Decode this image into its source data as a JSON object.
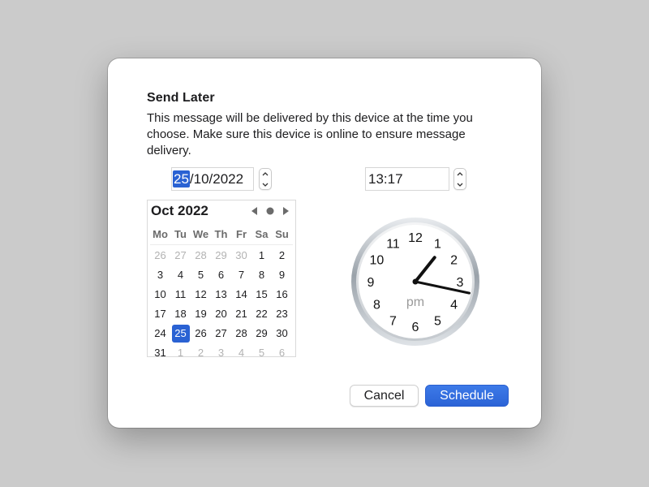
{
  "dialog": {
    "title": "Send Later",
    "description": "This message will be delivered by this device at the time you choose. Make sure this device is online to ensure message delivery."
  },
  "date_field": {
    "day": "25",
    "rest": "/10/2022"
  },
  "time_field": {
    "value": "13:17"
  },
  "calendar": {
    "month_label": "Oct 2022",
    "weekdays": [
      "Mo",
      "Tu",
      "We",
      "Th",
      "Fr",
      "Sa",
      "Su"
    ],
    "weeks": [
      [
        {
          "d": "26",
          "dim": true
        },
        {
          "d": "27",
          "dim": true
        },
        {
          "d": "28",
          "dim": true
        },
        {
          "d": "29",
          "dim": true
        },
        {
          "d": "30",
          "dim": true
        },
        {
          "d": "1"
        },
        {
          "d": "2"
        }
      ],
      [
        {
          "d": "3"
        },
        {
          "d": "4"
        },
        {
          "d": "5"
        },
        {
          "d": "6"
        },
        {
          "d": "7"
        },
        {
          "d": "8"
        },
        {
          "d": "9"
        }
      ],
      [
        {
          "d": "10"
        },
        {
          "d": "11"
        },
        {
          "d": "12"
        },
        {
          "d": "13"
        },
        {
          "d": "14"
        },
        {
          "d": "15"
        },
        {
          "d": "16"
        }
      ],
      [
        {
          "d": "17"
        },
        {
          "d": "18"
        },
        {
          "d": "19"
        },
        {
          "d": "20"
        },
        {
          "d": "21"
        },
        {
          "d": "22"
        },
        {
          "d": "23"
        }
      ],
      [
        {
          "d": "24"
        },
        {
          "d": "25",
          "selected": true
        },
        {
          "d": "26"
        },
        {
          "d": "27"
        },
        {
          "d": "28"
        },
        {
          "d": "29"
        },
        {
          "d": "30"
        }
      ],
      [
        {
          "d": "31"
        },
        {
          "d": "1",
          "dim": true
        },
        {
          "d": "2",
          "dim": true
        },
        {
          "d": "3",
          "dim": true
        },
        {
          "d": "4",
          "dim": true
        },
        {
          "d": "5",
          "dim": true
        },
        {
          "d": "6",
          "dim": true
        }
      ]
    ],
    "icons": {
      "prev": "triangle-left-icon",
      "today": "dot-icon",
      "next": "triangle-right-icon"
    }
  },
  "clock": {
    "numerals": [
      "12",
      "1",
      "2",
      "3",
      "4",
      "5",
      "6",
      "7",
      "8",
      "9",
      "10",
      "11"
    ],
    "period": "pm",
    "hour": 13,
    "minute": 17
  },
  "buttons": {
    "cancel": "Cancel",
    "schedule": "Schedule"
  },
  "colors": {
    "accent": "#2a62d3",
    "background": "#cbcbcb",
    "dialog": "#ffffff"
  }
}
